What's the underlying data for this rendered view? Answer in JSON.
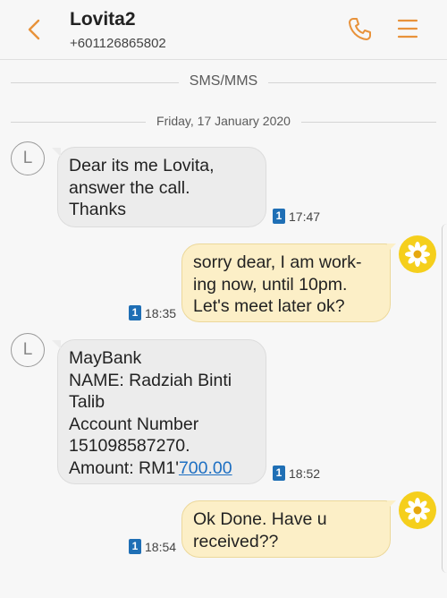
{
  "header": {
    "contact_name": "Lovita2",
    "phone_number": "+601126865802",
    "icons": {
      "back": "chevron-left-icon",
      "call": "phone-icon",
      "menu": "menu-icon"
    },
    "accent_color": "#e8923a"
  },
  "thread": {
    "channel_label": "SMS/MMS",
    "date_label": "Friday, 17 January 2020"
  },
  "messages": [
    {
      "direction": "incoming",
      "avatar_letter": "L",
      "lines": [
        "Dear its me Lovita,",
        "answer the call.",
        "Thanks"
      ],
      "sim": "1",
      "time": "17:47"
    },
    {
      "direction": "outgoing",
      "lines": [
        "sorry dear, I am work-",
        "ing now, until 10pm.",
        "Let's meet later ok?"
      ],
      "sim": "1",
      "time": "18:35"
    },
    {
      "direction": "incoming",
      "avatar_letter": "L",
      "lines": [
        "MayBank",
        "NAME: Radziah Binti",
        "Talib",
        "Account Number",
        "151098587270."
      ],
      "amount_prefix": "Amount: RM1'",
      "amount_link": "700.00",
      "sim": "1",
      "time": "18:52"
    },
    {
      "direction": "outgoing",
      "lines": [
        "Ok Done. Have u",
        "received??"
      ],
      "sim": "1",
      "time": "18:54"
    }
  ]
}
